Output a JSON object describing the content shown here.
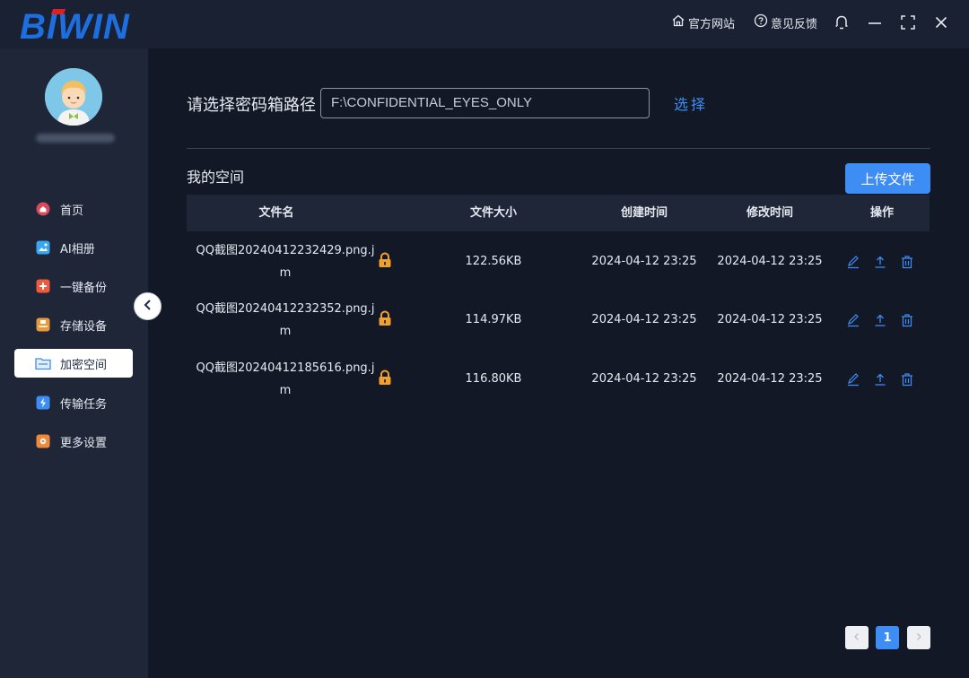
{
  "app": {
    "logo_text": "BIWIN"
  },
  "titlebar": {
    "official_site": "官方网站",
    "feedback": "意见反馈",
    "icons": [
      "home-icon",
      "help-circle-icon",
      "bell-icon",
      "minimize-icon",
      "fullscreen-icon",
      "close-icon"
    ]
  },
  "sidebar": {
    "items": [
      {
        "label": "首页",
        "icon": "home-icon",
        "color": "#d94a5a"
      },
      {
        "label": "AI相册",
        "icon": "photo-icon",
        "color": "#3aa6f0"
      },
      {
        "label": "一键备份",
        "icon": "backup-icon",
        "color": "#f05a3c"
      },
      {
        "label": "存储设备",
        "icon": "storage-icon",
        "color": "#e89a3a"
      },
      {
        "label": "加密空间",
        "icon": "folder-lock-icon",
        "color": "#3d8df5",
        "active": true
      },
      {
        "label": "传输任务",
        "icon": "transfer-icon",
        "color": "#3d8df5"
      },
      {
        "label": "更多设置",
        "icon": "settings-icon",
        "color": "#f08a3a"
      }
    ]
  },
  "main": {
    "path_label": "请选择密码箱路径",
    "path_value": "F:\\CONFIDENTIAL_EYES_ONLY",
    "choose_label": "选择",
    "section_title": "我的空间",
    "upload_label": "上传文件",
    "columns": [
      "文件名",
      "文件大小",
      "创建时间",
      "修改时间",
      "操作"
    ],
    "rows": [
      {
        "name": "QQ截图20240412232429.png.jm",
        "size": "122.56KB",
        "created": "2024-04-12 23:25",
        "modified": "2024-04-12 23:25"
      },
      {
        "name": "QQ截图20240412232352.png.jm",
        "size": "114.97KB",
        "created": "2024-04-12 23:25",
        "modified": "2024-04-12 23:25"
      },
      {
        "name": "QQ截图20240412185616.png.jm",
        "size": "116.80KB",
        "created": "2024-04-12 23:25",
        "modified": "2024-04-12 23:25"
      }
    ]
  },
  "pagination": {
    "current": "1"
  },
  "colors": {
    "accent": "#3d8df5",
    "lock": "#f0a030",
    "background": "#131826",
    "sidebar": "#1e2638"
  }
}
